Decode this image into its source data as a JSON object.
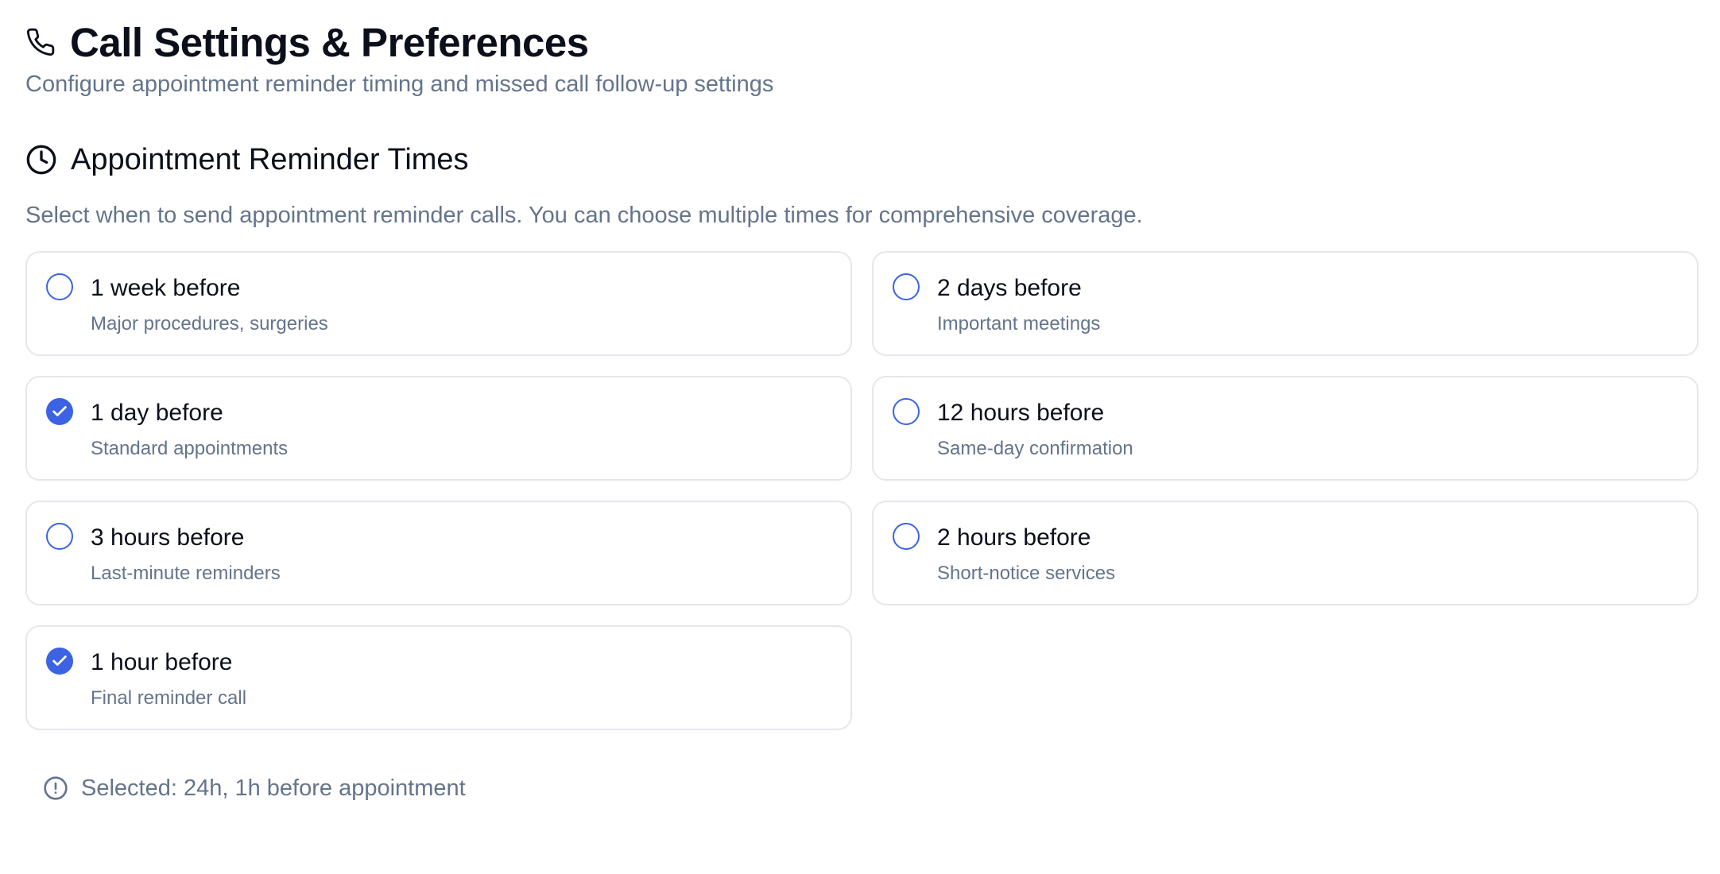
{
  "header": {
    "icon": "phone-icon",
    "title": "Call Settings & Preferences",
    "subtitle": "Configure appointment reminder timing and missed call follow-up settings"
  },
  "section": {
    "icon": "clock-icon",
    "title": "Appointment Reminder Times",
    "description": "Select when to send appointment reminder calls. You can choose multiple times for comprehensive coverage."
  },
  "options": [
    {
      "label": "1 week before",
      "description": "Major procedures, surgeries",
      "checked": false
    },
    {
      "label": "2 days before",
      "description": "Important meetings",
      "checked": false
    },
    {
      "label": "1 day before",
      "description": "Standard appointments",
      "checked": true
    },
    {
      "label": "12 hours before",
      "description": "Same-day confirmation",
      "checked": false
    },
    {
      "label": "3 hours before",
      "description": "Last-minute reminders",
      "checked": false
    },
    {
      "label": "2 hours before",
      "description": "Short-notice services",
      "checked": false
    },
    {
      "label": "1 hour before",
      "description": "Final reminder call",
      "checked": true
    }
  ],
  "summary": {
    "icon": "alert-circle-icon",
    "text": "Selected: 24h, 1h before appointment"
  },
  "colors": {
    "accent": "#3b63e4",
    "muted_text": "#64748b",
    "border": "#e5e7eb"
  }
}
